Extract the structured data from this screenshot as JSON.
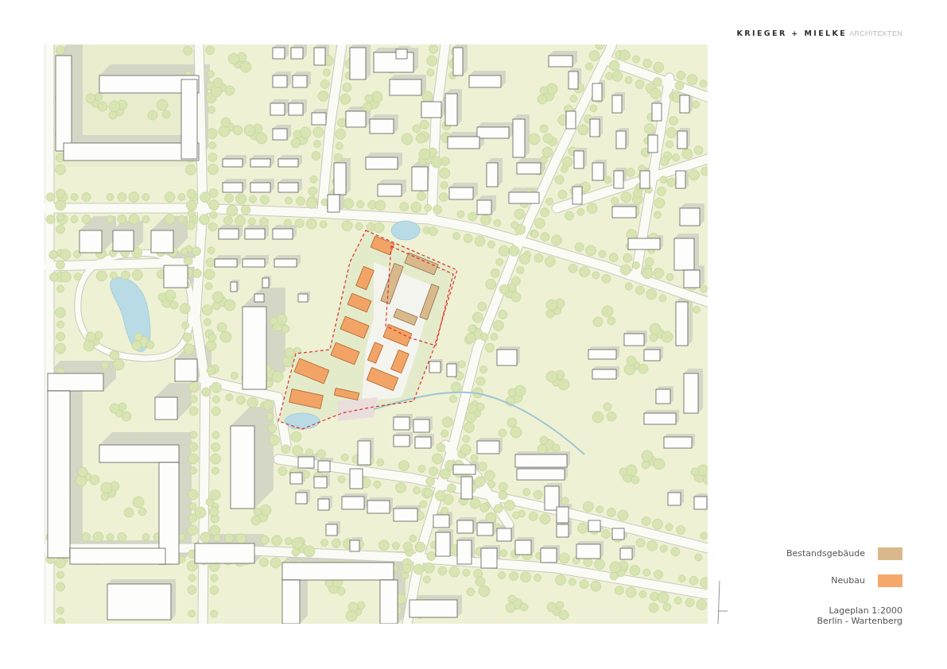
{
  "header": {
    "logo": {
      "name": "KRIEGER + MIELKE",
      "suffix": "ARCHITEKTEN"
    }
  },
  "legend": [
    {
      "label": "Bestandsgebäude",
      "color": "#d9b98c"
    },
    {
      "label": "Neubau",
      "color": "#f5a96c"
    }
  ],
  "caption": [
    "Lageplan 1:2000",
    "Berlin - Wartenberg"
  ]
}
